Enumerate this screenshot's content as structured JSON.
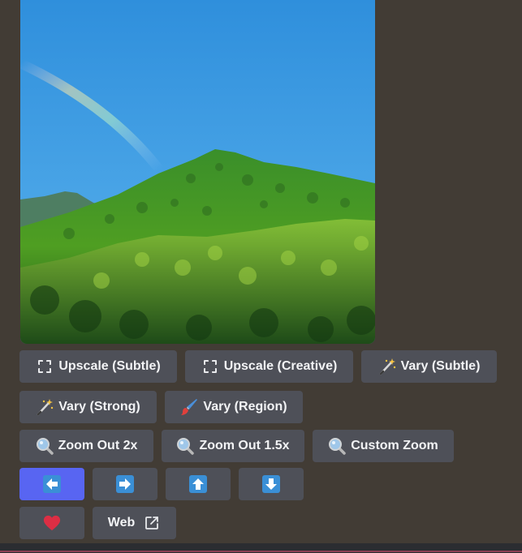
{
  "image": {
    "alt": "Generated image of a forested mountain with a rainbow in a blue sky"
  },
  "row1": {
    "upscale_subtle": "Upscale (Subtle)",
    "upscale_creative": "Upscale (Creative)",
    "vary_subtle": "Vary (Subtle)"
  },
  "row2": {
    "vary_strong": "Vary (Strong)",
    "vary_region": "Vary (Region)"
  },
  "row3": {
    "zoom_out_2x": "Zoom Out 2x",
    "zoom_out_1_5x": "Zoom Out 1.5x",
    "custom_zoom": "Custom Zoom"
  },
  "row5": {
    "web": "Web"
  },
  "colors": {
    "background": "#423c35",
    "button": "#4e5058",
    "primary_button": "#5865f2",
    "arrow_icon": "#3a8fd6",
    "heart": "#dd2e44"
  },
  "icons": {
    "upscale": "expand-arrows-icon",
    "vary": "magic-wand-icon",
    "region": "paintbrush-icon",
    "zoom": "magnifier-icon",
    "pan_left": "arrow-left-icon",
    "pan_right": "arrow-right-icon",
    "pan_up": "arrow-up-icon",
    "pan_down": "arrow-down-icon",
    "favorite": "heart-icon",
    "external": "external-link-icon"
  }
}
